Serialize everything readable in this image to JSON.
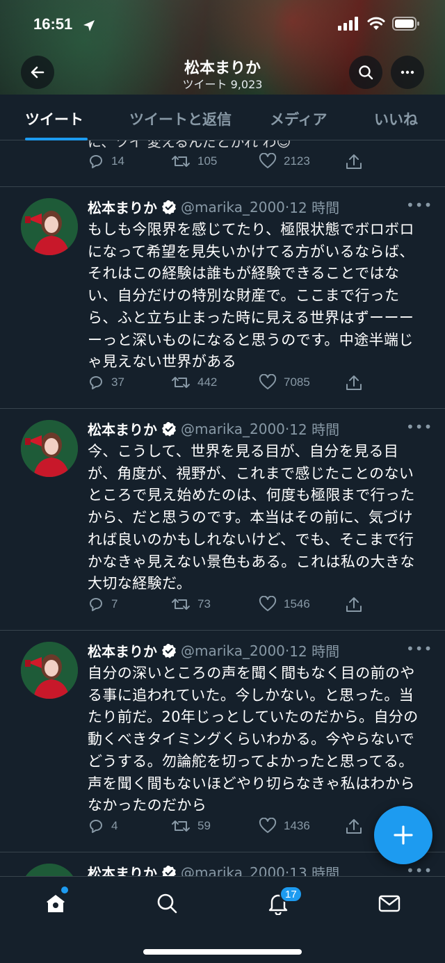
{
  "status_bar": {
    "time": "16:51"
  },
  "header": {
    "back_icon": "arrow-left-icon",
    "name": "松本まりか",
    "tweet_count": "ツイート 9,023",
    "search_icon": "search-icon",
    "more_icon": "ellipsis-icon"
  },
  "tabs": [
    {
      "label": "ツイート",
      "active": true
    },
    {
      "label": "ツイートと返信",
      "active": false
    },
    {
      "label": "メディア",
      "active": false
    },
    {
      "label": "いいね",
      "active": false
    }
  ],
  "partial_tweet": {
    "text_tail": "に、ツイ 変えるんだとかれ わ😊",
    "replies": "14",
    "retweets": "105",
    "likes": "2123"
  },
  "tweets": [
    {
      "name": "松本まりか",
      "handle": "@marika_2000",
      "dot": "·",
      "time": "12 時間",
      "text": "もしも今限界を感じてたり、極限状態でボロボロになって希望を見失いかけてる方がいるならば、それはこの経験は誰もが経験できることではない、自分だけの特別な財産で。ここまで行ったら、ふと立ち止まった時に見える世界はずーーーーっと深いものになると思うのです。中途半端じゃ見えない世界がある",
      "replies": "37",
      "retweets": "442",
      "likes": "7085"
    },
    {
      "name": "松本まりか",
      "handle": "@marika_2000",
      "dot": "·",
      "time": "12 時間",
      "text": "今、こうして、世界を見る目が、自分を見る目が、角度が、視野が、これまで感じたことのないところで見え始めたのは、何度も極限まで行ったから、だと思うのです。本当はその前に、気づければ良いのかもしれないけど、でも、そこまで行かなきゃ見えない景色もある。これは私の大きな大切な経験だ。",
      "replies": "7",
      "retweets": "73",
      "likes": "1546"
    },
    {
      "name": "松本まりか",
      "handle": "@marika_2000",
      "dot": "·",
      "time": "12 時間",
      "text": "自分の深いところの声を聞く間もなく目の前のやる事に追われていた。今しかない。と思った。当たり前だ。20年じっとしていたのだから。自分の動くべきタイミングくらいわかる。今やらないでどうする。勿論舵を切ってよかったと思ってる。声を聞く間もないほどやり切らなきゃ私はわからなかったのだから",
      "replies": "4",
      "retweets": "59",
      "likes": "1436"
    },
    {
      "name": "松本まりか",
      "handle": "@marika_2000",
      "dot": "·",
      "time": "13 時間",
      "text": "",
      "replies": "",
      "retweets": "",
      "likes": ""
    }
  ],
  "fab": {
    "icon": "compose-plus-icon"
  },
  "bottom_nav": {
    "items": [
      "home-icon",
      "search-icon",
      "bell-icon",
      "mail-icon"
    ],
    "notifications_badge": "17"
  },
  "colors": {
    "background": "#15202b",
    "accent": "#1d9bf0",
    "muted_text": "#8899a6",
    "divider": "#38444d"
  }
}
